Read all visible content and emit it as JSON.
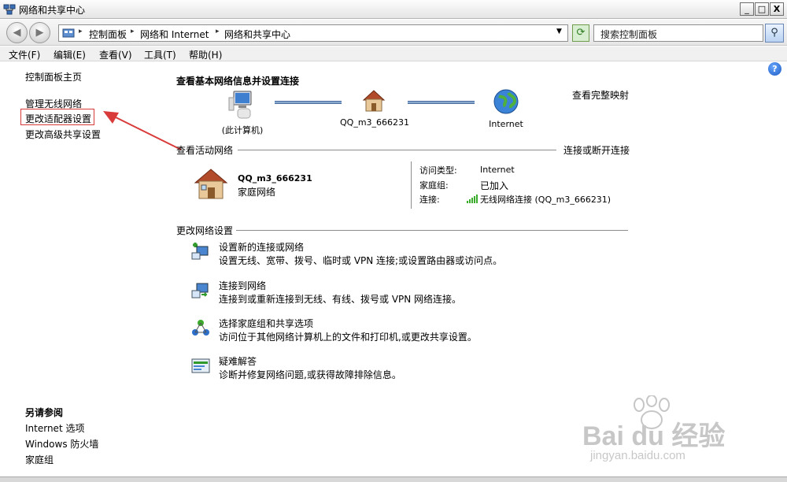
{
  "window": {
    "title": "网络和共享中心",
    "controls": [
      "_",
      "□",
      "X"
    ]
  },
  "address_bar": {
    "back_icon": "back-arrow-icon",
    "forward_icon": "forward-arrow-icon",
    "crumbs": [
      "控制面板",
      "网络和 Internet",
      "网络和共享中心"
    ],
    "search_placeholder": "搜索控制面板"
  },
  "menu": [
    {
      "label": "文件(F)"
    },
    {
      "label": "编辑(E)"
    },
    {
      "label": "查看(V)"
    },
    {
      "label": "工具(T)"
    },
    {
      "label": "帮助(H)"
    }
  ],
  "sidebar": {
    "home": "控制面板主页",
    "items": [
      "管理无线网络",
      "更改适配器设置",
      "更改高级共享设置"
    ]
  },
  "main": {
    "heading": "查看基本网络信息并设置连接",
    "full_map": "查看完整映射",
    "map": [
      {
        "label": "(此计算机)",
        "icon": "computer-icon"
      },
      {
        "label": "QQ_m3_666231",
        "icon": "home-icon"
      },
      {
        "label": "Internet",
        "icon": "globe-icon"
      }
    ],
    "active": {
      "title": "查看活动网络",
      "connect_link": "连接或断开连接",
      "network_name": "QQ_m3_666231",
      "network_type": "家庭网络",
      "access_label": "访问类型:",
      "access_value": "Internet",
      "group_label": "家庭组:",
      "group_value": "已加入",
      "conn_label": "连接:",
      "conn_value": "无线网络连接 (QQ_m3_666231)"
    },
    "settings_title": "更改网络设置",
    "tasks": [
      {
        "title": "设置新的连接或网络",
        "desc": "设置无线、宽带、拨号、临时或 VPN 连接;或设置路由器或访问点。",
        "icon": "new-connection-icon"
      },
      {
        "title": "连接到网络",
        "desc": "连接到或重新连接到无线、有线、拨号或 VPN 网络连接。",
        "icon": "connect-network-icon"
      },
      {
        "title": "选择家庭组和共享选项",
        "desc": "访问位于其他网络计算机上的文件和打印机,或更改共享设置。",
        "icon": "homegroup-icon"
      },
      {
        "title": "疑难解答",
        "desc": "诊断并修复网络问题,或获得故障排除信息。",
        "icon": "troubleshoot-icon"
      }
    ]
  },
  "see_also": {
    "title": "另请参阅",
    "items": [
      "Internet 选项",
      "Windows 防火墙",
      "家庭组"
    ]
  },
  "watermark": {
    "logo": "Bai du 经验",
    "url": "jingyan.baidu.com"
  },
  "colors": {
    "highlight_border": "#d93a3a",
    "arrow": "#d93a3a",
    "link": "#000000"
  }
}
